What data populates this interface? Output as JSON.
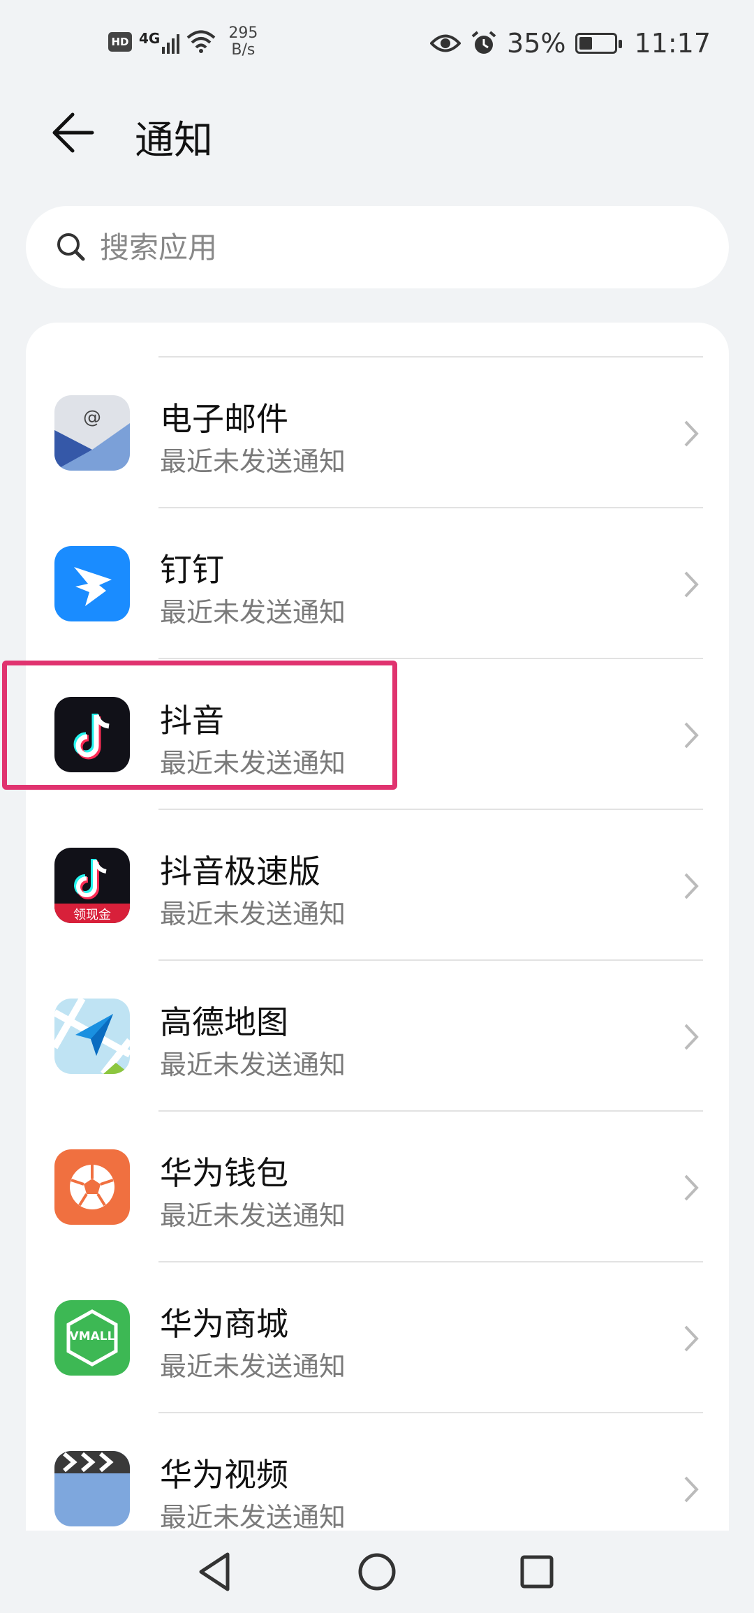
{
  "status_bar": {
    "hd": "HD",
    "signal": "4G",
    "net_speed_value": "295",
    "net_speed_unit": "B/s",
    "battery": "35%",
    "time": "11:17",
    "icons": [
      "hd-icon",
      "signal-icon",
      "wifi-icon",
      "eye-icon",
      "alarm-icon",
      "battery-icon"
    ]
  },
  "header": {
    "title": "通知",
    "back_icon": "arrow-left-icon"
  },
  "search": {
    "placeholder": "搜索应用",
    "icon": "search-icon"
  },
  "apps": [
    {
      "name": "电子邮件",
      "status": "最近未发送通知",
      "icon": "email-icon",
      "color": "#dfe2e8"
    },
    {
      "name": "钉钉",
      "status": "最近未发送通知",
      "icon": "dingtalk-icon",
      "color": "#1a8cff"
    },
    {
      "name": "抖音",
      "status": "最近未发送通知",
      "icon": "douyin-icon",
      "color": "#111118",
      "highlighted": true
    },
    {
      "name": "抖音极速版",
      "status": "最近未发送通知",
      "icon": "douyin-lite-icon",
      "color": "#111118",
      "badge": "领现金"
    },
    {
      "name": "高德地图",
      "status": "最近未发送通知",
      "icon": "amap-icon",
      "color": "#9fd4ee"
    },
    {
      "name": "华为钱包",
      "status": "最近未发送通知",
      "icon": "huawei-wallet-icon",
      "color": "#f07040"
    },
    {
      "name": "华为商城",
      "status": "最近未发送通知",
      "icon": "vmall-icon",
      "color": "#3db854",
      "badge": "VMALL"
    },
    {
      "name": "华为视频",
      "status": "最近未发送通知",
      "icon": "huawei-video-icon",
      "color": "#7ea7dd"
    }
  ],
  "highlight_color": "#e0336f",
  "nav": {
    "icons": [
      "back-triangle-icon",
      "home-circle-icon",
      "recents-square-icon"
    ]
  }
}
